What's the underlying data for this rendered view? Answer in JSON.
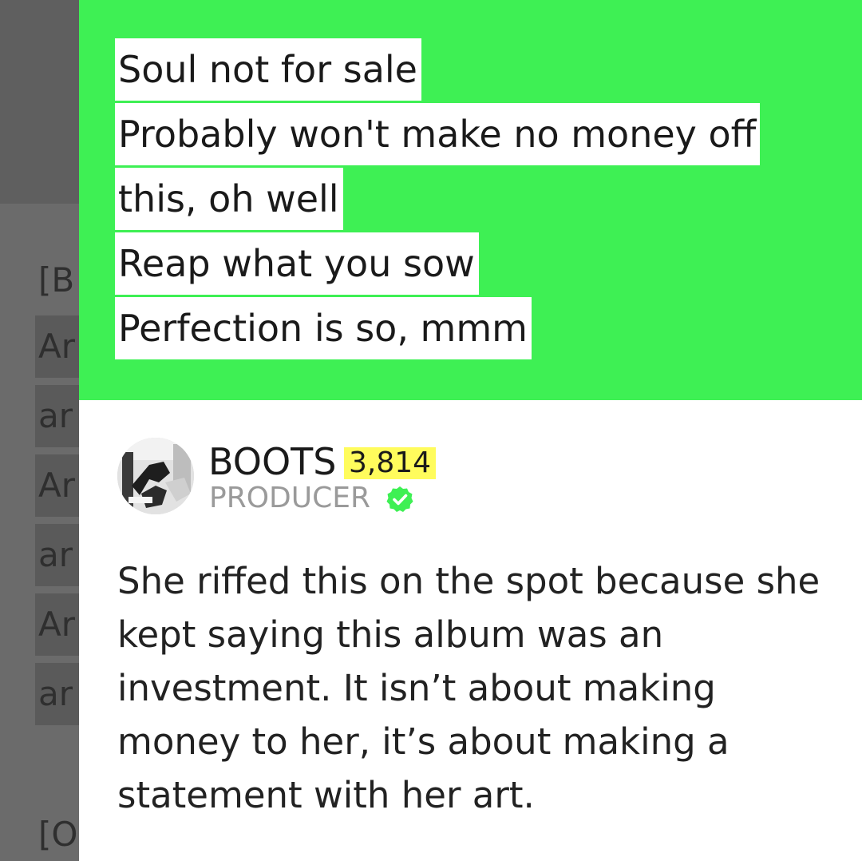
{
  "background_page": {
    "section_header_1": "[B",
    "section_header_2": "[O",
    "lines": [
      "Ar",
      "ar",
      "Ar",
      "ar",
      "Ar",
      "ar"
    ]
  },
  "annotation": {
    "lyrics": [
      "Soul not for sale",
      "Probably won't make no money off",
      "this, oh well",
      "Reap what you sow",
      "Perfection is so, mmm"
    ],
    "author": {
      "name": "BOOTS",
      "iq": "3,814",
      "role": "PRODUCER",
      "verified_icon": "verified-check-icon"
    },
    "body": "She riffed this on the spot because she kept saying this album was an investment. It isn’t about making money to her, it’s about making a statement with her art."
  },
  "colors": {
    "highlight_green": "#3ef054",
    "iq_yellow": "#fffc5c",
    "verified_green": "#3ef054",
    "overlay_gray": "#6b6b6b"
  }
}
